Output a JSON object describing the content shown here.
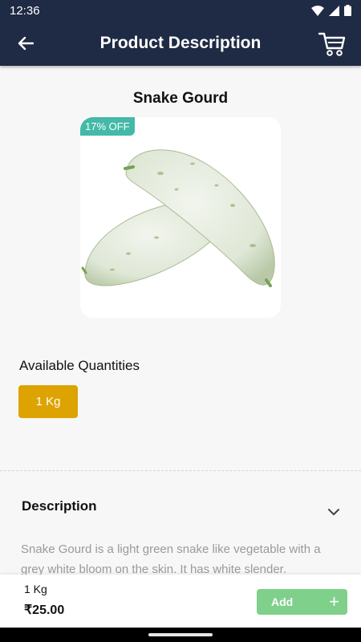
{
  "status_bar": {
    "time": "12:36"
  },
  "app_bar": {
    "title": "Product Description"
  },
  "product": {
    "name": "Snake Gourd",
    "discount_badge": "17% OFF",
    "image_alt": "snake-gourd-image"
  },
  "quantities": {
    "heading": "Available Quantities",
    "options": [
      "1 Kg"
    ],
    "selected": "1 Kg"
  },
  "description": {
    "heading": "Description",
    "text": "Snake Gourd is a light green snake like vegetable with a grey white bloom on the skin. It has white slender."
  },
  "bottom_bar": {
    "quantity": "1 Kg",
    "price": "₹25.00",
    "add_label": "Add",
    "add_plus": "+"
  },
  "colors": {
    "header": "#1f2a44",
    "badge": "#45b9a8",
    "qty_chip": "#dda300",
    "add_button": "#7ed08a"
  }
}
